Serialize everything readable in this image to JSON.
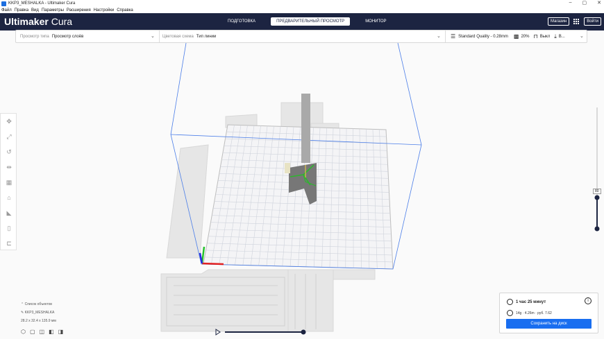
{
  "window": {
    "title": "KKP3_MESHALKA - Ultimaker Cura",
    "controls": [
      "–",
      "▢",
      "✕"
    ]
  },
  "menu": [
    "Файл",
    "Правка",
    "Вид",
    "Параметры",
    "Расширения",
    "Настройки",
    "Справка"
  ],
  "header": {
    "logo_bold": "Ultimaker",
    "logo_light": "Cura",
    "stages": [
      "ПОДГОТОВКА",
      "ПРЕДВАРИТЕЛЬНЫЙ ПРОСМОТР",
      "МОНИТОР"
    ],
    "active_stage": 1,
    "marketplace": "Магазин",
    "signin": "Войти"
  },
  "toolbar": {
    "view_type_label": "Просмотр типа",
    "view_type_value": "Просмотр слоёв",
    "color_scheme_label": "Цветовая схема",
    "color_scheme_value": "Тип линии",
    "profile": "Standard Quality - 0.28mm",
    "infill": "20%",
    "support": "Выкл",
    "adhesion": "В..."
  },
  "layer_slider": {
    "current": "80",
    "fraction": 0.72
  },
  "object_list": {
    "toggle": "Список объектов",
    "object_name": "KKP3_MESHALKA",
    "dimensions": "28.2 x 32.4 x 135.9 мм"
  },
  "playback": {
    "progress": 1.0
  },
  "print_info": {
    "time": "1 час 25 минут",
    "material": "14g · 4.26m · руб. 7.62",
    "save_button": "Сохранить на диск"
  },
  "colors": {
    "header_bg": "#1c2441",
    "accent": "#196ef0",
    "volume_lines": "#4a7de8"
  },
  "icons": {
    "tools": [
      "move-icon",
      "scale-icon",
      "rotate-icon",
      "mirror-icon",
      "per-model-settings-icon",
      "support-blocker-icon",
      "arrange-icon",
      "layer-icon",
      "cylinder-icon",
      "stack-icon"
    ]
  }
}
